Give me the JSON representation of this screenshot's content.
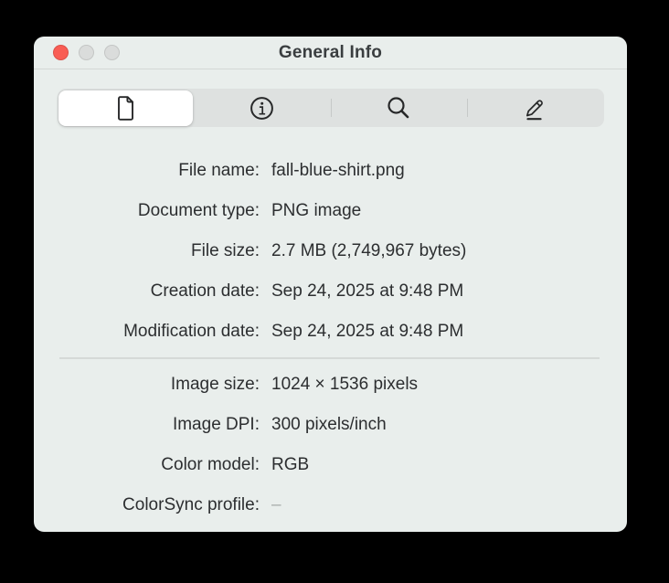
{
  "window": {
    "title": "General Info"
  },
  "traffic_lights": {
    "close_color": "#F95D54",
    "disabled_color": "#DADCDB"
  },
  "toolbar": {
    "tabs": [
      {
        "name": "general",
        "icon": "document-icon",
        "selected": true
      },
      {
        "name": "more-info",
        "icon": "info-icon",
        "selected": false
      },
      {
        "name": "keywords",
        "icon": "search-icon",
        "selected": false
      },
      {
        "name": "annotations",
        "icon": "markup-icon",
        "selected": false
      }
    ]
  },
  "general_section": {
    "rows": [
      {
        "label": "File name:",
        "value": "fall-blue-shirt.png"
      },
      {
        "label": "Document type:",
        "value": "PNG image"
      },
      {
        "label": "File size:",
        "value": "2.7 MB (2,749,967 bytes)"
      },
      {
        "label": "Creation date:",
        "value": "Sep 24, 2025 at 9:48 PM"
      },
      {
        "label": "Modification date:",
        "value": "Sep 24, 2025 at 9:48 PM"
      }
    ]
  },
  "image_section": {
    "rows": [
      {
        "label": "Image size:",
        "value": "1024 × 1536 pixels"
      },
      {
        "label": "Image DPI:",
        "value": "300 pixels/inch"
      },
      {
        "label": "Color model:",
        "value": "RGB"
      },
      {
        "label": "ColorSync profile:",
        "value": "–"
      }
    ]
  },
  "colors": {
    "window_background": "#E9EEEC",
    "segmented_track": "#DEE1E0",
    "selected_segment": "#FFFFFF",
    "text": "#2C2E30",
    "muted_text": "#A9AEAC"
  }
}
